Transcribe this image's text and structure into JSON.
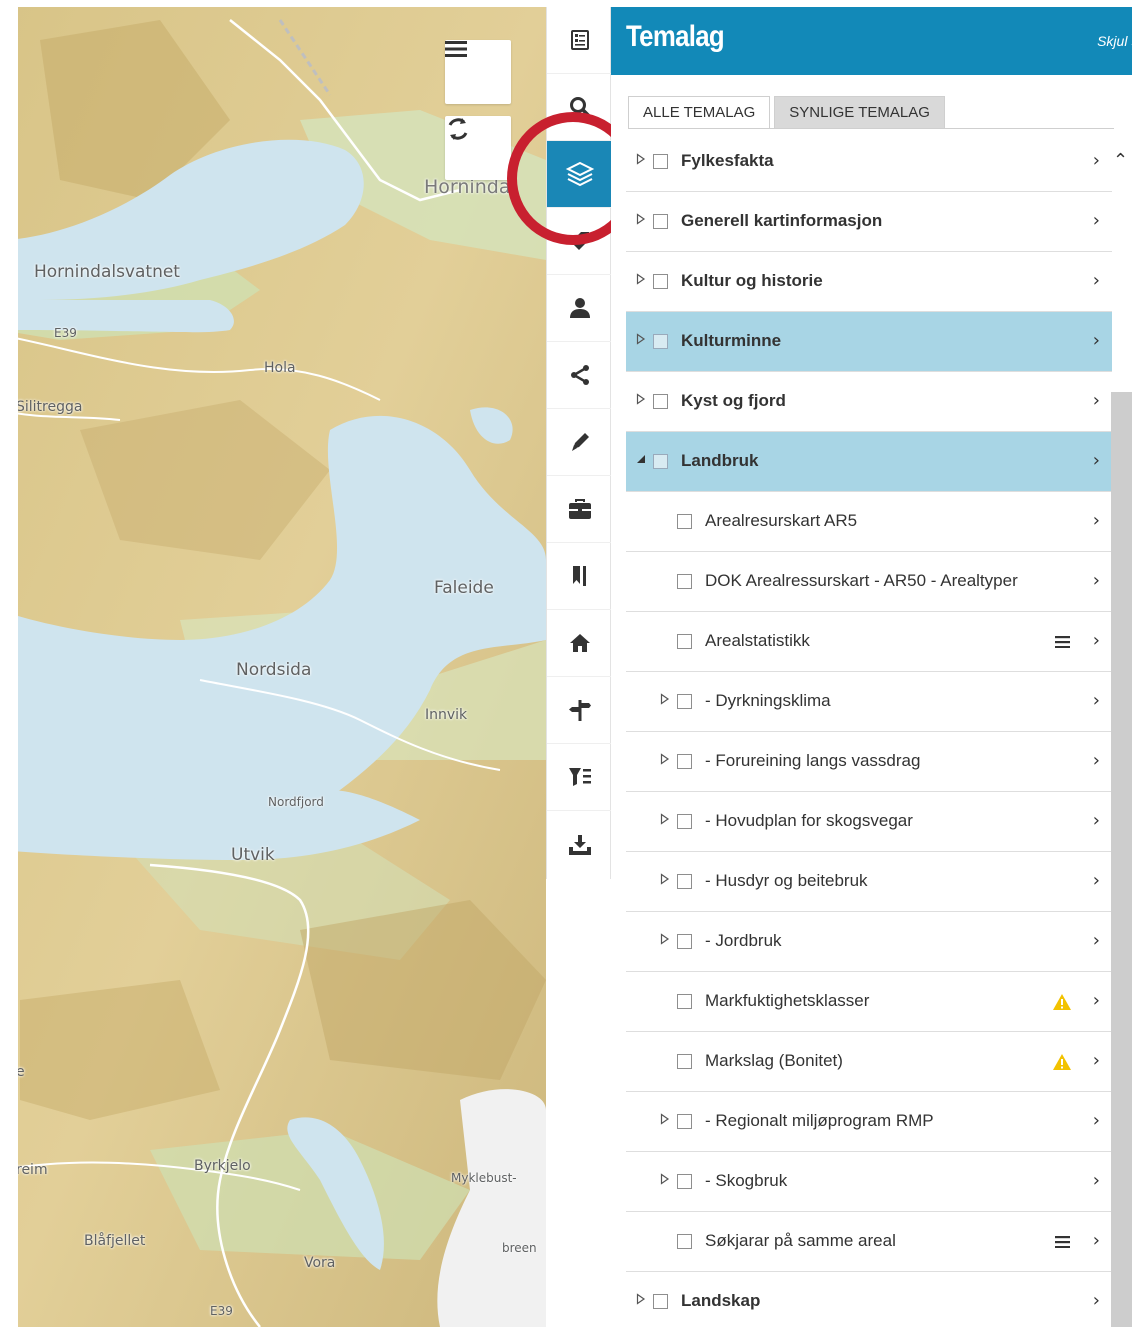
{
  "map": {
    "labels": [
      {
        "text": "Hornindal",
        "cls": "big"
      },
      {
        "text": "Hornindalsvatnet",
        "cls": "med"
      },
      {
        "text": "E39",
        "cls": "xs"
      },
      {
        "text": "Hola",
        "cls": "sm"
      },
      {
        "text": "Silitregga",
        "cls": "sm"
      },
      {
        "text": "Faleide",
        "cls": "med"
      },
      {
        "text": "Nordsida",
        "cls": "med"
      },
      {
        "text": "Innvik",
        "cls": "sm"
      },
      {
        "text": "Nordfjord",
        "cls": "xs"
      },
      {
        "text": "Utvik",
        "cls": "med"
      },
      {
        "text": "Byrkjelo",
        "cls": "sm"
      },
      {
        "text": "Myklebust-",
        "cls": "xs"
      },
      {
        "text": "reim",
        "cls": "sm"
      },
      {
        "text": "Blåfjellet",
        "cls": "sm"
      },
      {
        "text": "Vora",
        "cls": "sm"
      },
      {
        "text": "breen",
        "cls": "xs"
      },
      {
        "text": "E39",
        "cls": "xs"
      },
      {
        "text": "e",
        "cls": "sm"
      }
    ],
    "buttons": {
      "menu": "menu-icon",
      "refresh": "refresh-icon"
    }
  },
  "toolbar": {
    "items": [
      {
        "name": "legend-icon"
      },
      {
        "name": "search-icon"
      },
      {
        "name": "layers-icon"
      },
      {
        "name": "tag-icon"
      },
      {
        "name": "user-icon"
      },
      {
        "name": "share-icon"
      },
      {
        "name": "pencil-icon"
      },
      {
        "name": "toolbox-icon"
      },
      {
        "name": "bookmark-icon"
      },
      {
        "name": "home-icon"
      },
      {
        "name": "signpost-icon"
      },
      {
        "name": "filter-icon"
      },
      {
        "name": "download-icon"
      }
    ],
    "active_color": "#1a87b6"
  },
  "highlight_color": "#c8202f",
  "panel": {
    "title": "Temalag",
    "hide_label": "Skjul ›",
    "header_color": "#1289b8",
    "tabs": [
      {
        "label": "ALLE TEMALAG"
      },
      {
        "label": "SYNLIGE TEMALAG"
      }
    ],
    "rows": [
      {
        "label": "Fylkesfakta",
        "level": 0,
        "expand": "collapsed",
        "bold": true
      },
      {
        "label": "Generell kartinformasjon",
        "level": 0,
        "expand": "collapsed",
        "bold": true
      },
      {
        "label": "Kultur og historie",
        "level": 0,
        "expand": "collapsed",
        "bold": true
      },
      {
        "label": "Kulturminne",
        "level": 0,
        "expand": "collapsed",
        "bold": true,
        "highlight": true
      },
      {
        "label": "Kyst og fjord",
        "level": 0,
        "expand": "collapsed",
        "bold": true
      },
      {
        "label": "Landbruk",
        "level": 0,
        "expand": "expanded",
        "bold": true,
        "highlight": true
      },
      {
        "label": "Arealresurskart AR5",
        "level": 1,
        "expand": "none"
      },
      {
        "label": "DOK Arealressurskart - AR50 - Arealtyper",
        "level": 1,
        "expand": "none"
      },
      {
        "label": "Arealstatistikk",
        "level": 1,
        "expand": "none",
        "extra": "menu"
      },
      {
        "label": "- Dyrkningsklima",
        "level": 1,
        "expand": "collapsed"
      },
      {
        "label": "- Forureining langs vassdrag",
        "level": 1,
        "expand": "collapsed"
      },
      {
        "label": "- Hovudplan for skogsvegar",
        "level": 1,
        "expand": "collapsed"
      },
      {
        "label": "- Husdyr og beitebruk",
        "level": 1,
        "expand": "collapsed"
      },
      {
        "label": "- Jordbruk",
        "level": 1,
        "expand": "collapsed"
      },
      {
        "label": "Markfuktighetsklasser",
        "level": 1,
        "expand": "none",
        "extra": "warning"
      },
      {
        "label": "Markslag (Bonitet)",
        "level": 1,
        "expand": "none",
        "extra": "warning"
      },
      {
        "label": "- Regionalt miljøprogram RMP",
        "level": 1,
        "expand": "collapsed"
      },
      {
        "label": "- Skogbruk",
        "level": 1,
        "expand": "collapsed"
      },
      {
        "label": "Søkjarar på samme areal",
        "level": 1,
        "expand": "none",
        "extra": "menu"
      },
      {
        "label": "Landskap",
        "level": 0,
        "expand": "collapsed",
        "bold": true
      }
    ],
    "highlight_color": "#a8d5e5",
    "warning_color": "#f2c200"
  }
}
